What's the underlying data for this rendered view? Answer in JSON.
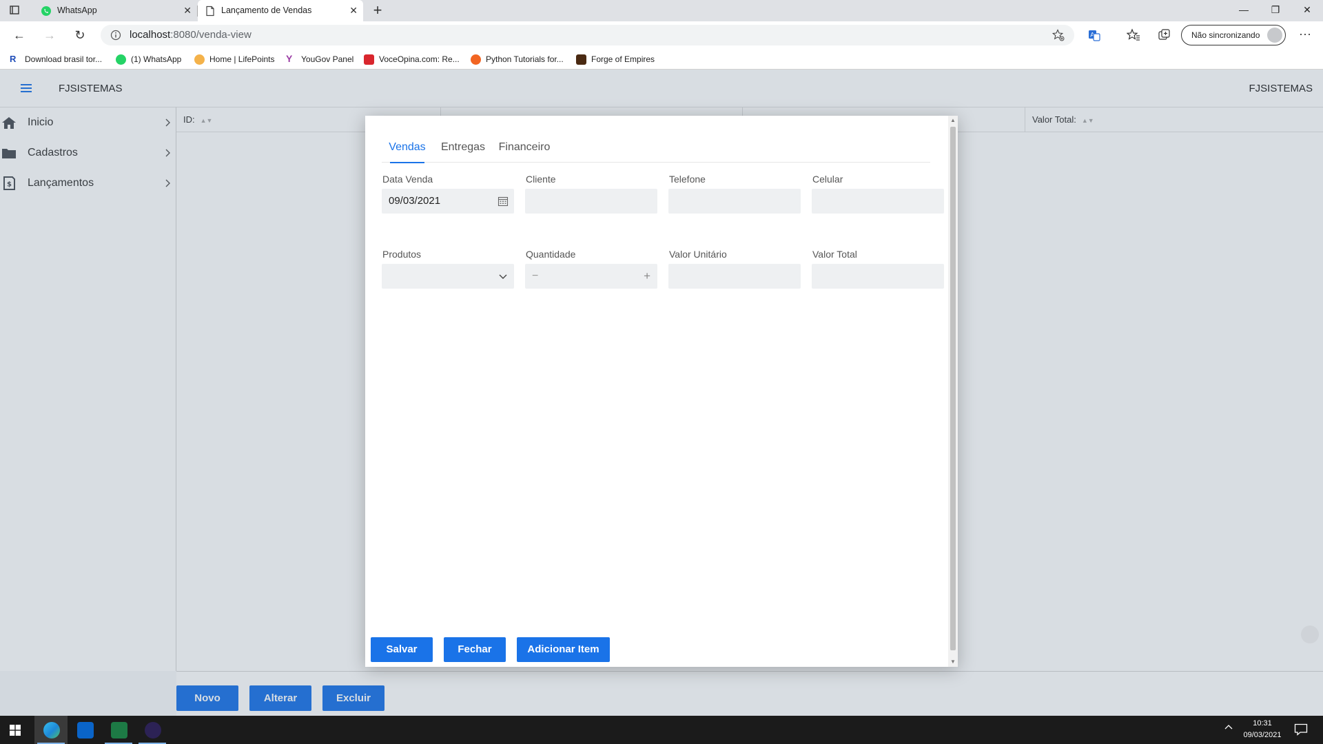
{
  "browser": {
    "tabs": [
      {
        "label": "WhatsApp",
        "icon": "whatsapp-icon"
      },
      {
        "label": "Lançamento de Vendas",
        "icon": "page-icon"
      }
    ],
    "url_host": "localhost",
    "url_path": ":8080/venda-view",
    "sync_label": "Não sincronizando",
    "bookmarks": [
      {
        "label": "Download brasil tor...",
        "icon": "r-icon",
        "color": "#1f4db8"
      },
      {
        "label": "(1) WhatsApp",
        "icon": "whatsapp-icon",
        "color": "#25d366"
      },
      {
        "label": "Home | LifePoints",
        "icon": "lifepoints-icon",
        "color": "#f4b24a"
      },
      {
        "label": "YouGov Panel",
        "icon": "yougov-icon",
        "color": "#9b3da5"
      },
      {
        "label": "VoceOpina.com: Re...",
        "icon": "voceopina-icon",
        "color": "#d9262d"
      },
      {
        "label": "Python Tutorials for...",
        "icon": "python-tutorials-icon",
        "color": "#f26522"
      },
      {
        "label": "Forge of Empires",
        "icon": "forge-of-empires-icon",
        "color": "#4a2a12"
      }
    ]
  },
  "app": {
    "title": "FJSISTEMAS",
    "title_right": "FJSISTEMAS",
    "accent": "#1a73e8",
    "nav": [
      {
        "label": "Inicio",
        "icon": "home-icon"
      },
      {
        "label": "Cadastros",
        "icon": "folder-icon"
      },
      {
        "label": "Lançamentos",
        "icon": "invoice-icon"
      }
    ],
    "grid_headers": [
      "ID:",
      "",
      "",
      "Valor Total:"
    ],
    "footer_buttons": {
      "novo": "Novo",
      "alterar": "Alterar",
      "excluir": "Excluir"
    }
  },
  "dialog": {
    "tabs": [
      "Vendas",
      "Entregas",
      "Financeiro"
    ],
    "selected_tab": "Vendas",
    "labels": {
      "data_venda": "Data Venda",
      "cliente": "Cliente",
      "telefone": "Telefone",
      "celular": "Celular",
      "produtos": "Produtos",
      "quantidade": "Quantidade",
      "valor_unitario": "Valor Unitário",
      "valor_total": "Valor Total"
    },
    "values": {
      "data_venda": "09/03/2021",
      "cliente": "",
      "telefone": "",
      "celular": "",
      "produtos": "",
      "quantidade": "",
      "valor_unitario": "",
      "valor_total": ""
    },
    "quantity_minus": "−",
    "quantity_plus": "+",
    "buttons": {
      "salvar": "Salvar",
      "fechar": "Fechar",
      "adicionar": "Adicionar Item"
    }
  },
  "taskbar": {
    "apps": [
      "edge-icon",
      "outlook-icon",
      "excel-icon",
      "eclipse-icon"
    ],
    "time": "10:31",
    "date": "09/03/2021"
  }
}
